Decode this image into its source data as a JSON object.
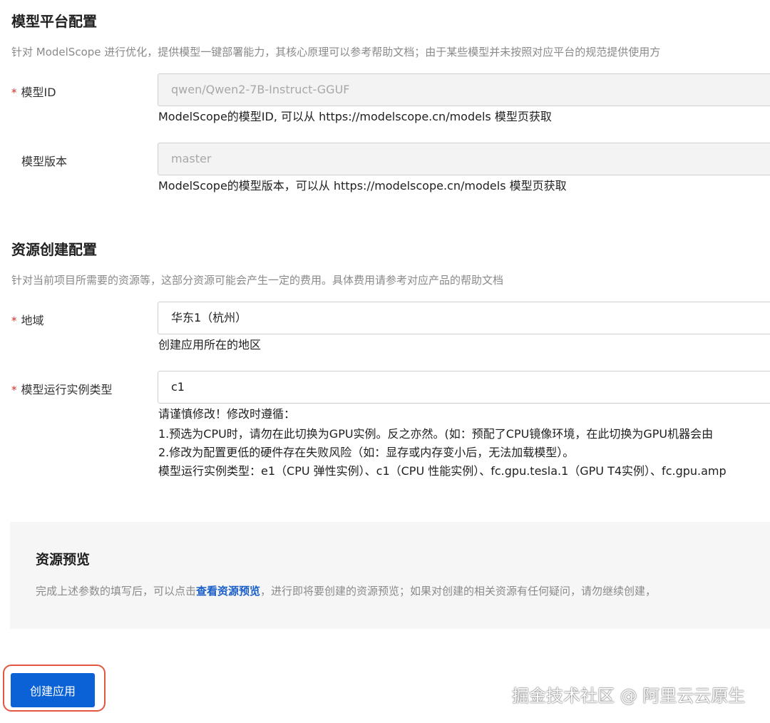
{
  "model_platform": {
    "title": "模型平台配置",
    "description": "针对 ModelScope 进行优化，提供模型一键部署能力，其核心原理可以参考帮助文档；由于某些模型并未按照对应平台的规范提供使用方",
    "model_id": {
      "required_mark": "*",
      "label": "模型ID",
      "value": "qwen/Qwen2-7B-Instruct-GGUF",
      "help": "ModelScope的模型ID, 可以从 https://modelscope.cn/models 模型页获取"
    },
    "model_version": {
      "label": "模型版本",
      "value": "master",
      "help": "ModelScope的模型版本，可以从 https://modelscope.cn/models 模型页获取"
    }
  },
  "resource_config": {
    "title": "资源创建配置",
    "description": "针对当前项目所需要的资源等，这部分资源可能会产生一定的费用。具体费用请参考对应产品的帮助文档",
    "region": {
      "required_mark": "*",
      "label": "地域",
      "value": "华东1（杭州）",
      "help": "创建应用所在的地区"
    },
    "instance_type": {
      "required_mark": "*",
      "label": "模型运行实例类型",
      "value": "c1",
      "help_lines": [
        "请谨慎修改！修改时遵循：",
        "1.预选为CPU时，请勿在此切换为GPU实例。反之亦然。(如：预配了CPU镜像环境，在此切换为GPU机器会由",
        "2.修改为配置更低的硬件存在失败风险（如：显存或内存变小后，无法加载模型）。",
        "模型运行实例类型：e1（CPU 弹性实例）、c1（CPU 性能实例）、fc.gpu.tesla.1（GPU T4实例）、fc.gpu.amp"
      ]
    }
  },
  "preview": {
    "title": "资源预览",
    "desc_before": "完成上述参数的填写后，可以点击",
    "link": "查看资源预览",
    "desc_after": "，进行即将要创建的资源预览；如果对创建的相关资源有任何疑问，请勿继续创建，"
  },
  "actions": {
    "create_label": "创建应用"
  },
  "watermark": "掘金技术社区 @ 阿里云云原生",
  "colors": {
    "primary": "#0a62d6",
    "required": "#d93026",
    "link": "#1a5fc8",
    "highlight": "#e2553f"
  }
}
